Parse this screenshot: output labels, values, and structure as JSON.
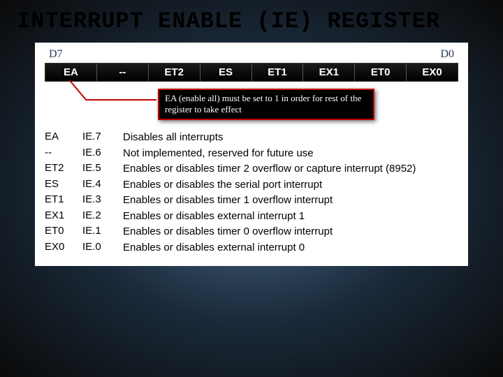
{
  "title": "INTERRUPT ENABLE (IE) REGISTER",
  "msb_label": "D7",
  "lsb_label": "D0",
  "bits": [
    "EA",
    "--",
    "ET2",
    "ES",
    "ET1",
    "EX1",
    "ET0",
    "EX0"
  ],
  "callout": "EA (enable all) must be set to 1 in order for rest of the register to take effect",
  "rows": [
    {
      "sym": "EA",
      "bit": "IE.7",
      "desc": "Disables all interrupts"
    },
    {
      "sym": "--",
      "bit": "IE.6",
      "desc": "Not implemented, reserved for future use"
    },
    {
      "sym": "ET2",
      "bit": "IE.5",
      "desc": "Enables or disables timer 2 overflow or capture interrupt (8952)"
    },
    {
      "sym": "ES",
      "bit": "IE.4",
      "desc": "Enables or disables the serial port interrupt"
    },
    {
      "sym": "ET1",
      "bit": "IE.3",
      "desc": "Enables or disables timer 1 overflow interrupt"
    },
    {
      "sym": "EX1",
      "bit": "IE.2",
      "desc": "Enables or disables external interrupt 1"
    },
    {
      "sym": "ET0",
      "bit": "IE.1",
      "desc": "Enables or disables timer 0 overflow interrupt"
    },
    {
      "sym": "EX0",
      "bit": "IE.0",
      "desc": "Enables or disables external interrupt 0"
    }
  ]
}
